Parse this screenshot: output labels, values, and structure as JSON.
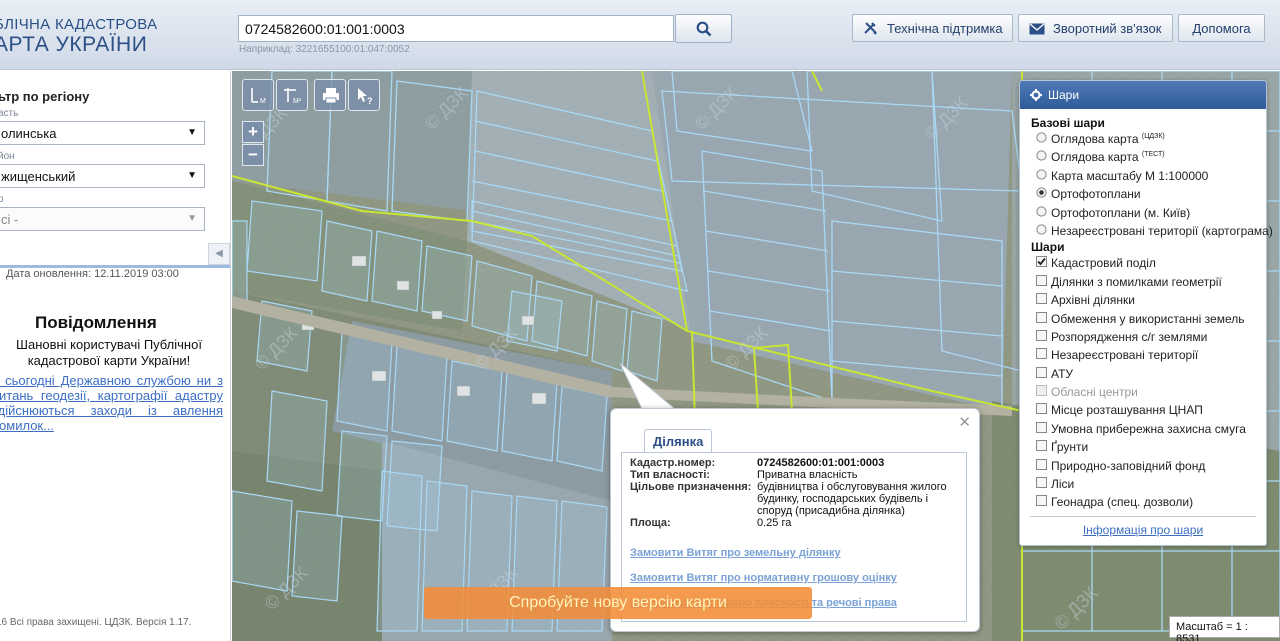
{
  "header": {
    "logo_line1": "БЛІЧНА КАДАСТРОВА",
    "logo_line2": "АРТА УКРАЇНИ",
    "search_value": "0724582600:01:001:0003",
    "search_hint": "Наприклад: 3221655100:01:047:0052",
    "buttons": {
      "support": "Технічна підтримка",
      "feedback": "Зворотний зв'язок",
      "help": "Допомога"
    }
  },
  "sidebar": {
    "filter_title": "ьтр по регіону",
    "region_label": "асть",
    "region_value": "олинська",
    "district_label": "йон",
    "district_value": "жищенський",
    "council_label": "о",
    "council_value": "сі -",
    "updated": "Дата оновлення: 12.11.2019 03:00",
    "news_title": "Повідомлення",
    "news_body": "Шановні користувачі Публічної кадастрової карти України!",
    "news_link": "а сьогодні Державною службою ни з питань геодезії, картографії адастру здійснюються заходи із авлення помилок...",
    "copyright": "16 Всі права захищені. ЦДЗК. Версія 1.17."
  },
  "popup": {
    "tab": "Ділянка",
    "rows": [
      {
        "k": "Кадастр.номер:",
        "v": "0724582600:01:001:0003"
      },
      {
        "k": "Тип власності:",
        "v": "Приватна власність"
      },
      {
        "k": "Цільове призначення:",
        "v": "будівництва і обслуговування жилого будинку, господарських будівель і споруд (присадибна ділянка)"
      },
      {
        "k": "Площа:",
        "v": "0.25 га"
      }
    ],
    "links": [
      "Замовити Витяг про земельну ділянку",
      "Замовити Витяг про нормативну грошову оцінку",
      "Інформація про право власності та речові права"
    ]
  },
  "banner": "Спробуйте нову версію карти",
  "layers": {
    "title": "Шари",
    "base_title": "Базові шари",
    "base": [
      {
        "label": "Оглядова карта",
        "sup": "(ЦДЗК)",
        "selected": false
      },
      {
        "label": "Оглядова карта",
        "sup": "(ТЕСТ)",
        "selected": false
      },
      {
        "label": "Карта масштабу М 1:100000",
        "sup": "",
        "selected": false
      },
      {
        "label": "Ортофотоплани",
        "sup": "",
        "selected": true
      },
      {
        "label": "Ортофотоплани (м. Київ)",
        "sup": "",
        "selected": false
      },
      {
        "label": "Незареєстровані території (картограма)",
        "sup": "",
        "selected": false
      }
    ],
    "overlay_title": "Шари",
    "overlays": [
      {
        "label": "Кадастровий поділ",
        "checked": true,
        "disabled": false
      },
      {
        "label": "Ділянки з помилками геометрії",
        "checked": false,
        "disabled": false
      },
      {
        "label": "Архівні ділянки",
        "checked": false,
        "disabled": false
      },
      {
        "label": "Обмеження у використанні земель",
        "checked": false,
        "disabled": false
      },
      {
        "label": "Розпорядження с/г землями",
        "checked": false,
        "disabled": false
      },
      {
        "label": "Незареєстровані території",
        "checked": false,
        "disabled": false
      },
      {
        "label": "АТУ",
        "checked": false,
        "disabled": false
      },
      {
        "label": "Обласні центри",
        "checked": false,
        "disabled": true
      },
      {
        "label": "Місце розташування ЦНАП",
        "checked": false,
        "disabled": false
      },
      {
        "label": "Умовна прибережна захисна смуга",
        "checked": false,
        "disabled": false
      },
      {
        "label": "Ґрунти",
        "checked": false,
        "disabled": false
      },
      {
        "label": "Природно-заповідний фонд",
        "checked": false,
        "disabled": false
      },
      {
        "label": "Ліси",
        "checked": false,
        "disabled": false
      },
      {
        "label": "Геонадра (спец. дозволи)",
        "checked": false,
        "disabled": false
      }
    ],
    "info_link": "Інформація про шари"
  },
  "scale": "Масштаб = 1 : 8531",
  "watermark": "© ДЗК",
  "colors": {
    "accent": "#2f5b9b",
    "parcel": "#a9d8f5",
    "boundary": "#c8e632",
    "banner": "#f28c37"
  }
}
